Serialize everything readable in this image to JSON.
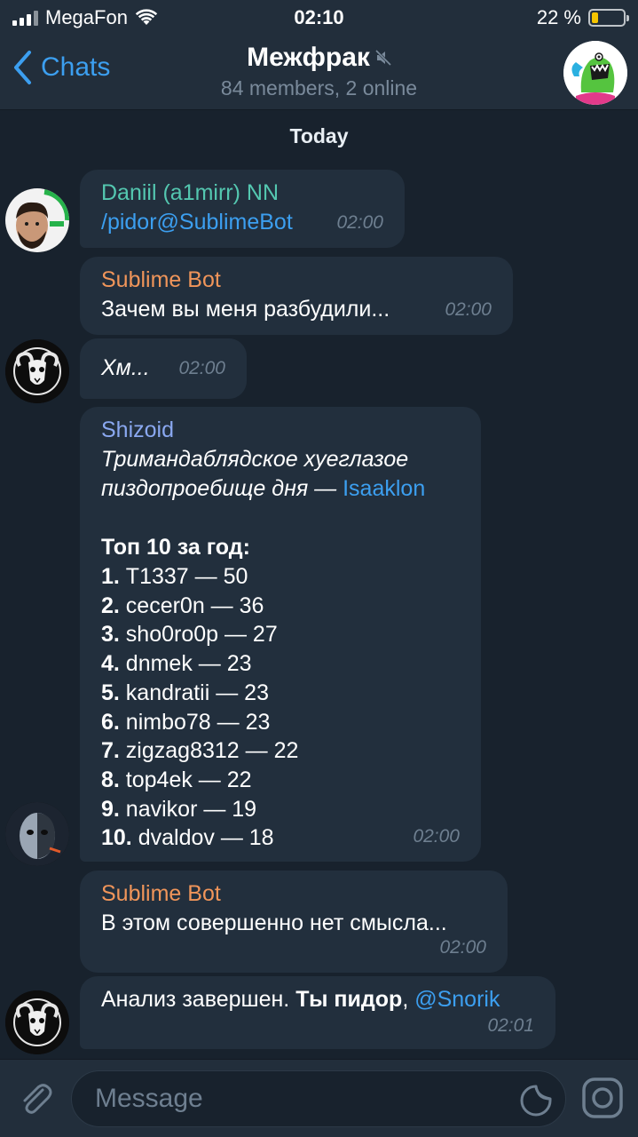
{
  "status_bar": {
    "carrier": "MegaFon",
    "time": "02:10",
    "battery_text": "22 %",
    "battery_level": 0.22,
    "battery_color": "#f5c400"
  },
  "nav": {
    "back_label": "Chats",
    "title": "Межфрак",
    "muted_icon": "muted-speaker-icon",
    "subtitle": "84 members, 2 online"
  },
  "date_label": "Today",
  "messages": [
    {
      "sender": "Daniil (a1mirr) NN",
      "sender_color": "#54c7b0",
      "text": "/pidor@SublimeBot",
      "time": "02:00"
    },
    {
      "sender": "Sublime Bot",
      "sender_color": "#f0955a",
      "text": "Зачем вы меня разбудили...",
      "time": "02:00"
    },
    {
      "text": "Хм...",
      "time": "02:00"
    },
    {
      "sender": "Shizoid",
      "sender_color": "#8aa8f0",
      "line1": "Тримандаблядское хуеглазое",
      "line2": "пиздопроебище дня — ",
      "mention": "Isaaklon",
      "top_title": "Топ 10 за год:",
      "top": [
        {
          "rank": "1.",
          "entry": "T1337 — 50"
        },
        {
          "rank": "2.",
          "entry": "cecer0n — 36"
        },
        {
          "rank": "3.",
          "entry": "sho0ro0p — 27"
        },
        {
          "rank": "4.",
          "entry": "dnmek — 23"
        },
        {
          "rank": "5.",
          "entry": "kandratii — 23"
        },
        {
          "rank": "6.",
          "entry": "nimbo78 — 23"
        },
        {
          "rank": "7.",
          "entry": "zigzag8312 — 22"
        },
        {
          "rank": "8.",
          "entry": "top4ek — 22"
        },
        {
          "rank": "9.",
          "entry": "navikor — 19"
        },
        {
          "rank": "10.",
          "entry": "dvaldov — 18"
        }
      ],
      "time": "02:00"
    },
    {
      "sender": "Sublime Bot",
      "sender_color": "#f0955a",
      "text": "В этом совершенно нет смысла...",
      "time": "02:00"
    },
    {
      "text_plain": "Анализ завершен. ",
      "text_bold": "Ты пидор",
      "text_sep": ", ",
      "mention": "@Snorik",
      "time": "02:01"
    }
  ],
  "input": {
    "placeholder": "Message"
  },
  "colors": {
    "background": "#18222d",
    "bar": "#222e3b",
    "bubble": "#222f3d",
    "accent": "#3c9ff0"
  }
}
